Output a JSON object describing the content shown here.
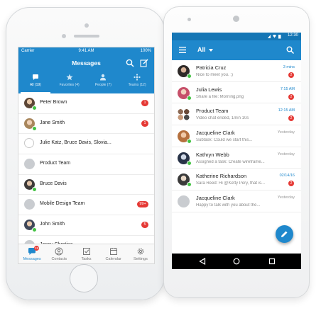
{
  "ios": {
    "status": {
      "carrier": "Carrier",
      "time": "9:41 AM",
      "battery": "100%"
    },
    "title": "Messages",
    "tabs": [
      {
        "label": "All (19)",
        "icon": "chat-bubble-icon"
      },
      {
        "label": "Favorites (4)",
        "icon": "star-icon"
      },
      {
        "label": "People (7)",
        "icon": "person-icon"
      },
      {
        "label": "Teams (12)",
        "icon": "team-icon"
      }
    ],
    "conversations": [
      {
        "name": "Peter Brown",
        "badge": "1"
      },
      {
        "name": "Jane Smith",
        "badge": "1"
      },
      {
        "name": "Julie Katz, Bruce Davis, Slovia...",
        "badge": ""
      },
      {
        "name": "Product Team",
        "badge": ""
      },
      {
        "name": "Bruce Davis",
        "badge": ""
      },
      {
        "name": "Mobile Design Team",
        "badge": "99+"
      },
      {
        "name": "John Smith",
        "badge": "5"
      },
      {
        "name": "Jenny Chrstina",
        "badge": ""
      }
    ],
    "tabbar": [
      {
        "label": "Messages",
        "icon": "messages-icon",
        "badge": "19"
      },
      {
        "label": "Contacts",
        "icon": "contacts-icon"
      },
      {
        "label": "Tasks",
        "icon": "tasks-icon"
      },
      {
        "label": "Calendar",
        "icon": "calendar-icon"
      },
      {
        "label": "Settings",
        "icon": "settings-icon"
      }
    ]
  },
  "android": {
    "status": {
      "time": "12:30"
    },
    "filter": "All",
    "conversations": [
      {
        "name": "Patricia Cruz",
        "snippet": "Nice to meet you. :)",
        "time": "3 mins",
        "badge": "2"
      },
      {
        "name": "Julia Lewis",
        "snippet": "Share a file: Morning.png",
        "time": "7:15 AM",
        "badge": "2"
      },
      {
        "name": "Product Team",
        "snippet": "Video chat ended, 1min 10s",
        "time": "12:15 AM",
        "badge": "2"
      },
      {
        "name": "Jacqueline Clark",
        "snippet": "Subtask: Could we start this...",
        "time": "Yesterday",
        "badge": ""
      },
      {
        "name": "Kathryn Webb",
        "snippet": "Assigned a task: Create wireframe...",
        "time": "Yesterday",
        "badge": ""
      },
      {
        "name": "Katherine Richardson",
        "snippet": "Sara Reed: Hi @Ketty Pery, that is...",
        "time": "02/14/16",
        "badge": "2"
      },
      {
        "name": "Jacqueline Clark",
        "snippet": "Happy to talk with you about the...",
        "time": "Yesterday",
        "badge": ""
      }
    ]
  }
}
